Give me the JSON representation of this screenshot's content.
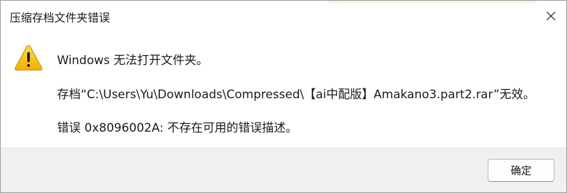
{
  "window": {
    "title": "压缩存档文件夹错误"
  },
  "icons": {
    "close": "close-icon",
    "warning": "warning-icon"
  },
  "message": {
    "line1": "Windows 无法打开文件夹。",
    "line2": "存档“C:\\Users\\Yu\\Downloads\\Compressed\\【ai中配版】Amakano3.part2.rar”无效。",
    "line3": "错误 0x8096002A: 不存在可用的错误描述。"
  },
  "buttons": {
    "ok_label": "确定"
  },
  "colors": {
    "warning_fill": "#f5c518",
    "warning_stroke": "#b8860b",
    "footer_bg": "#f0f0f0",
    "button_bg": "#fdfdfd"
  }
}
